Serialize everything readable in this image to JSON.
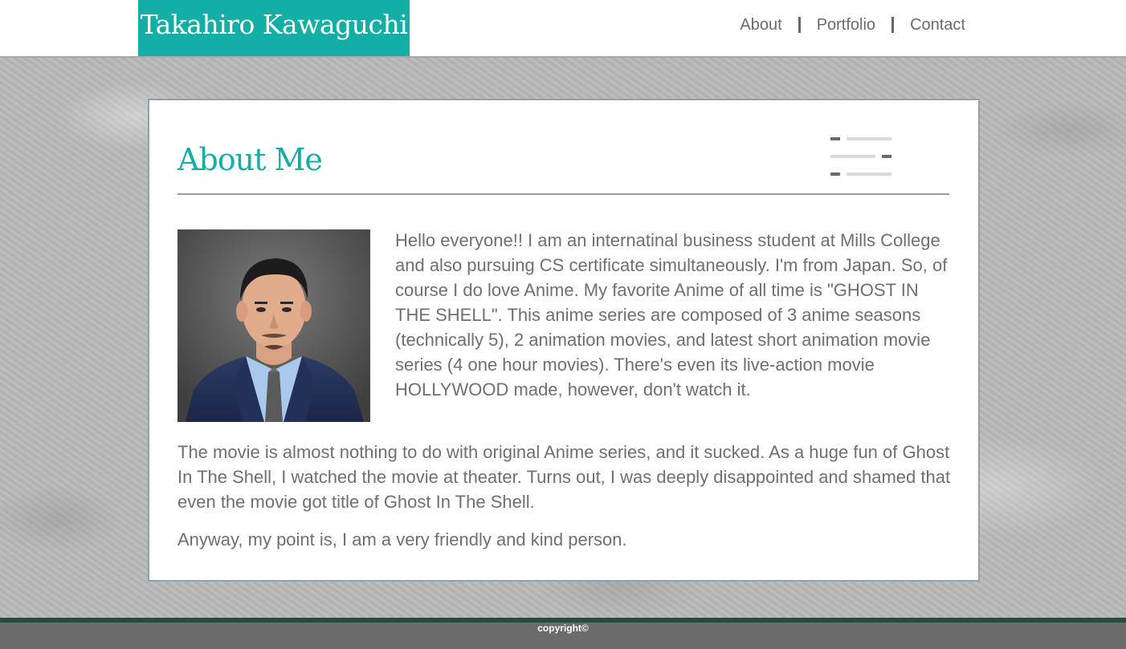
{
  "header": {
    "brand": "Takahiro Kawaguchi",
    "nav": [
      {
        "label": "About"
      },
      {
        "label": "Portfolio"
      },
      {
        "label": "Contact"
      }
    ]
  },
  "main": {
    "title": "About Me",
    "icon": "menu-lines-icon",
    "photo": "profile-photo",
    "paragraphs": [
      "Hello everyone!! I am an internatinal business student at Mills College and also pursuing CS certificate simultaneously. I'm from Japan. So, of course I do love Anime. My favorite Anime of all time is \"GHOST IN THE SHELL\". This anime series are composed of 3 anime seasons (technically 5), 2 animation movies, and latest short animation movie series (4 one hour movies). There's even its live-action movie HOLLYWOOD made, however, don't watch it.",
      "The movie is almost nothing to do with original Anime series, and it sucked. As a huge fun of Ghost In The Shell, I watched the movie at theater. Turns out, I was deeply disappointed and shamed that even the movie got title of Ghost In The Shell.",
      "Anyway, my point is, I am a very friendly and kind person."
    ]
  },
  "footer": {
    "copyright": "copyright©"
  },
  "colors": {
    "accent": "#13aea5",
    "text": "#6f6f6f",
    "footer": "#6b6b6b",
    "footer_band": "#274a3e"
  }
}
